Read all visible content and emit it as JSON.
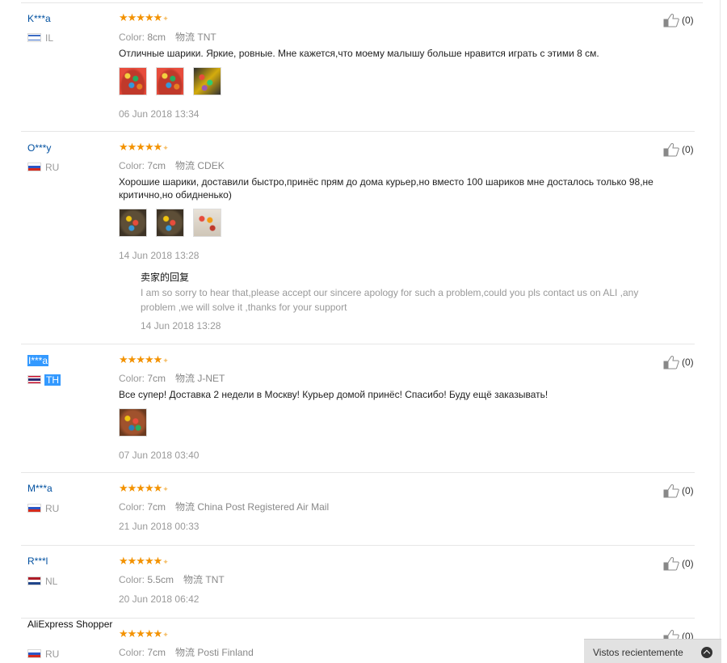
{
  "labels": {
    "color": "Color:",
    "shipping": "物流"
  },
  "reviews": [
    {
      "user": "K***a",
      "country": "IL",
      "color_value": "8cm",
      "shipping_value": "TNT",
      "rating": 5,
      "text": "Отличные шарики. Яркие, ровные. Мне кажется,что моему малышу больше нравится играть с этими 8 см.",
      "photos": [
        "ball-red",
        "ball-red",
        "ball-yellow"
      ],
      "date": "06 Jun 2018 13:34",
      "helpful": "(0)"
    },
    {
      "user": "O***y",
      "country": "RU",
      "color_value": "7cm",
      "shipping_value": "CDEK",
      "rating": 5,
      "text": "Хорошие шарики, доставили быстро,принёс прям до дома курьер,но вместо 100 шариков мне досталось только 98,не критично,но обидненько)",
      "photos": [
        "ball-dark",
        "ball-dark",
        "ball-light"
      ],
      "date": "14 Jun 2018 13:28",
      "helpful": "(0)",
      "seller_reply": {
        "title": "卖家的回复",
        "text": "I am so sorry to hear that,please accept our sincere apology for such a problem,could you pls contact us on ALI ,any problem ,we will solve it ,thanks for your support",
        "date": "14 Jun 2018 13:28"
      }
    },
    {
      "user": "I***a",
      "country": "TH",
      "color_value": "7cm",
      "shipping_value": "J-NET",
      "rating": 5,
      "text": "Все супер! Доставка 2 недели в Москву! Курьер домой принёс! Спасибо! Буду ещё заказывать!",
      "photos": [
        "ball-basket"
      ],
      "date": "07 Jun 2018 03:40",
      "helpful": "(0)"
    },
    {
      "user": "M***a",
      "country": "RU",
      "color_value": "7cm",
      "shipping_value": "China Post Registered Air Mail",
      "rating": 5,
      "date": "21 Jun 2018 00:33",
      "helpful": "(0)"
    },
    {
      "user": "R***l",
      "country": "NL",
      "color_value": "5.5cm",
      "shipping_value": "TNT",
      "rating": 5,
      "date": "20 Jun 2018 06:42",
      "helpful": "(0)"
    },
    {
      "user": "AliExpress Shopper",
      "country": "RU",
      "color_value": "7cm",
      "shipping_value": "Posti Finland",
      "rating": 5,
      "helpful": "(0)"
    }
  ],
  "recently_viewed": "Vistos recientemente",
  "icons": {
    "stars": "star-icon",
    "helpful": "thumbs-up-icon",
    "recent_toggle": "chevron-up-icon"
  },
  "colors": {
    "star": "#f39200",
    "username": "#0050a0",
    "selection": "#3399ff"
  }
}
